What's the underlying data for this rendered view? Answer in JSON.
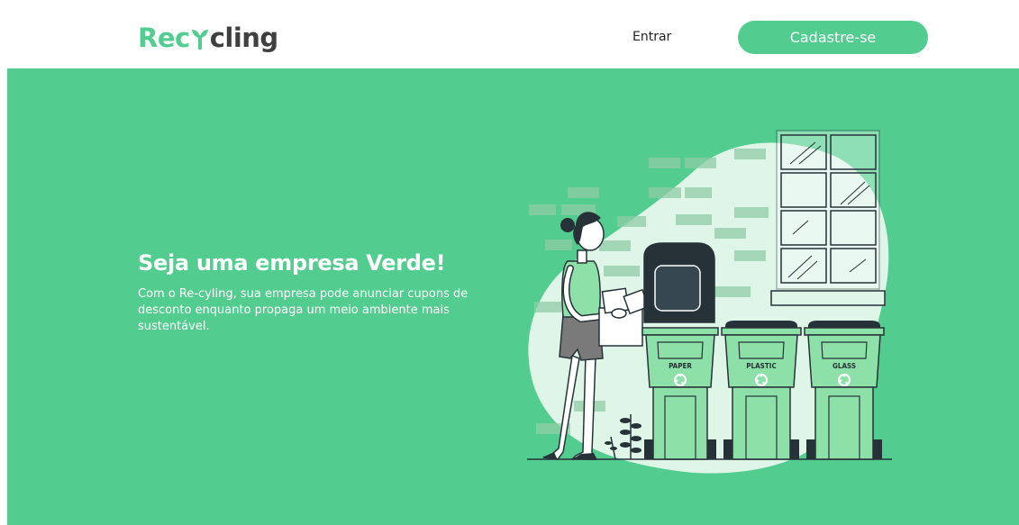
{
  "header": {
    "logo": {
      "prefix": "Rec",
      "suffix": "cling"
    },
    "nav": {
      "login_label": "Entrar",
      "signup_label": "Cadastre-se"
    }
  },
  "hero": {
    "title": "Seja uma empresa Verde!",
    "description": "Com o Re-cyling, sua empresa pode anunciar cupons de desconto enquanto propaga um meio ambiente mais sustentável.",
    "bins": [
      {
        "label": "PAPER"
      },
      {
        "label": "PLASTIC"
      },
      {
        "label": "GLASS"
      }
    ]
  },
  "colors": {
    "brand": "#52cd8f",
    "bin_green": "#8ee0a9",
    "dark": "#263238"
  }
}
